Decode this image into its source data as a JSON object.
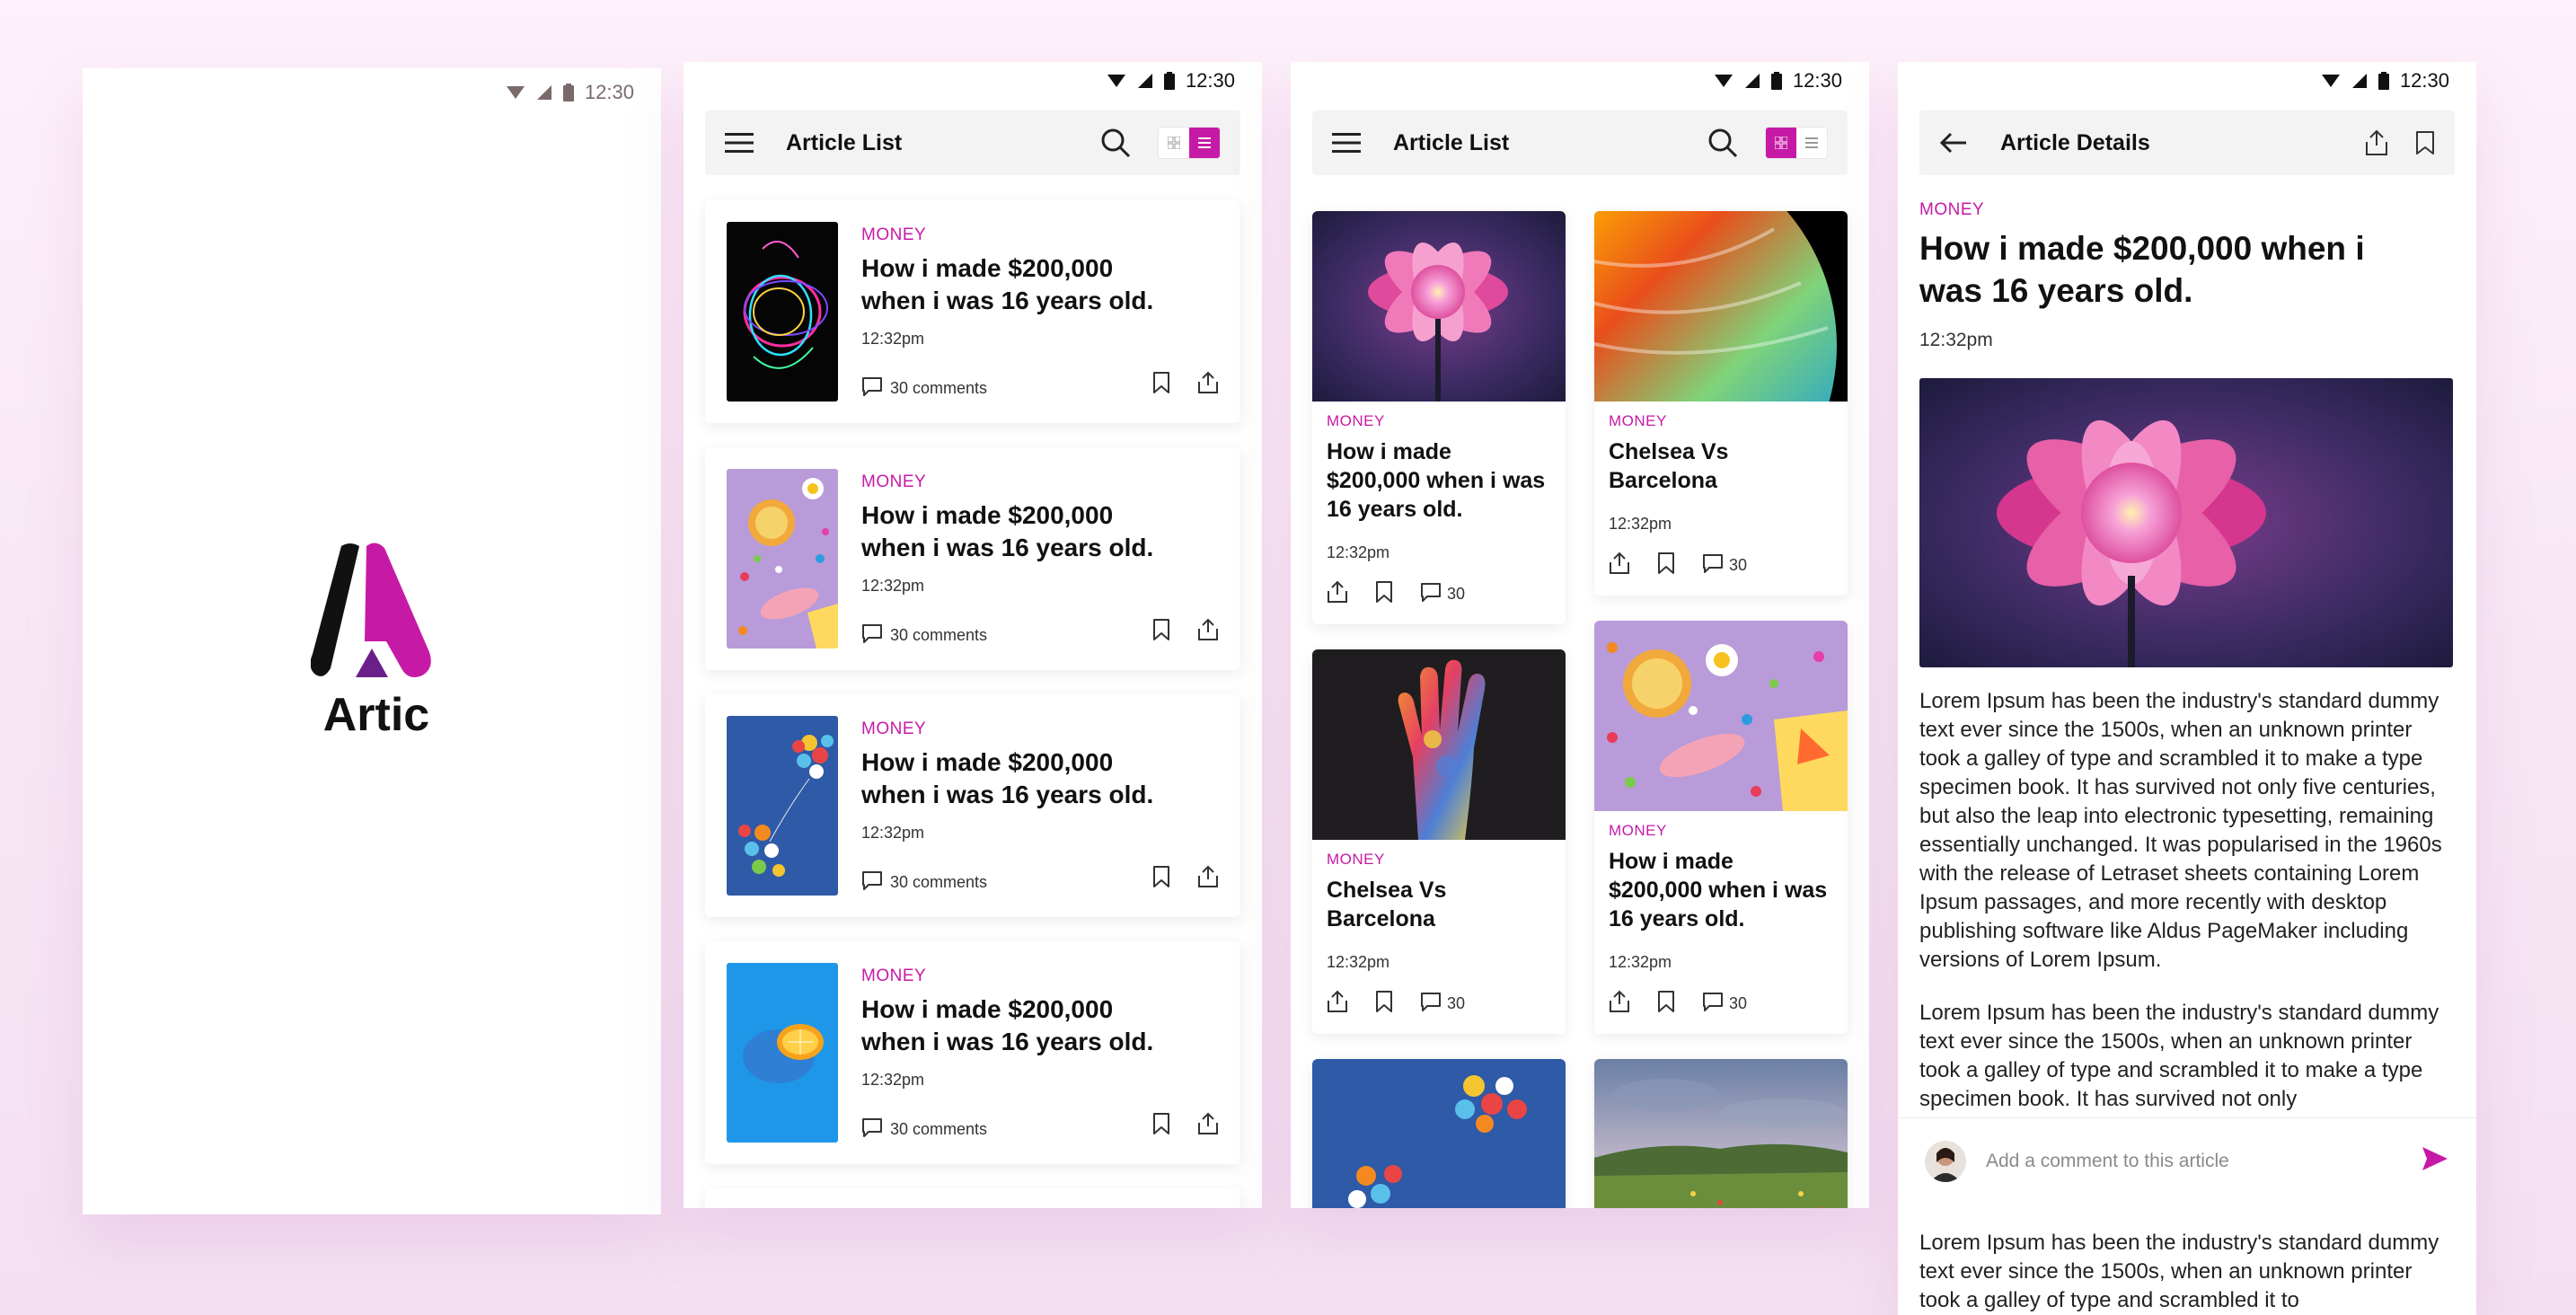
{
  "colors": {
    "accent": "#c61aa6",
    "text": "#111111",
    "toolbar_bg": "#f3f3f4"
  },
  "status": {
    "time": "12:30"
  },
  "splash": {
    "app_name": "Artic"
  },
  "list_screen": {
    "title": "Article List",
    "cards": [
      {
        "category": "MONEY",
        "headline": "How i made $200,000 when i was 16 years old.",
        "time": "12:32pm",
        "comments": "30 comments",
        "image": "light-swirl"
      },
      {
        "category": "MONEY",
        "headline": "How i made $200,000 when i was 16 years old.",
        "time": "12:32pm",
        "comments": "30 comments",
        "image": "candy"
      },
      {
        "category": "MONEY",
        "headline": "How i made $200,000 when i was 16 years old.",
        "time": "12:32pm",
        "comments": "30 comments",
        "image": "balloons"
      },
      {
        "category": "MONEY",
        "headline": "How i made $200,000 when i was 16 years old.",
        "time": "12:32pm",
        "comments": "30 comments",
        "image": "orange"
      }
    ]
  },
  "grid_screen": {
    "title": "Article List",
    "col1": [
      {
        "category": "MONEY",
        "headline": "How i made $200,000 when i was 16 years old.",
        "time": "12:32pm",
        "comments": "30",
        "image": "flower"
      },
      {
        "category": "MONEY",
        "headline": "Chelsea Vs Barcelona",
        "time": "12:32pm",
        "comments": "30",
        "image": "hand"
      },
      {
        "image": "balloons"
      }
    ],
    "col2": [
      {
        "category": "MONEY",
        "headline": "Chelsea Vs Barcelona",
        "time": "12:32pm",
        "comments": "30",
        "image": "planet"
      },
      {
        "category": "MONEY",
        "headline": "How i made $200,000 when i was 16 years old.",
        "time": "12:32pm",
        "comments": "30",
        "image": "candy"
      },
      {
        "image": "field"
      }
    ]
  },
  "details_screen": {
    "title": "Article Details",
    "category": "MONEY",
    "headline": "How i made $200,000 when i was 16 years old.",
    "time": "12:32pm",
    "paragraph1": "Lorem Ipsum has been the industry's standard dummy text ever since the 1500s, when an unknown printer took a galley of type and scrambled it to make a type specimen book. It has survived not only five centuries, but also the leap into electronic typesetting, remaining essentially unchanged. It was popularised in the 1960s with the release of Letraset sheets containing Lorem Ipsum passages, and more recently with desktop publishing software like Aldus PageMaker including versions of Lorem Ipsum.",
    "paragraph2": "Lorem Ipsum has been the industry's standard dummy text ever since the 1500s, when an unknown printer took a galley of type and scrambled it to make a type specimen book. It has survived not only",
    "paragraph3": "Lorem Ipsum has been the industry's standard dummy text ever since the 1500s, when an unknown printer took a galley of type and scrambled it to",
    "comment_placeholder": "Add a comment to this article"
  }
}
